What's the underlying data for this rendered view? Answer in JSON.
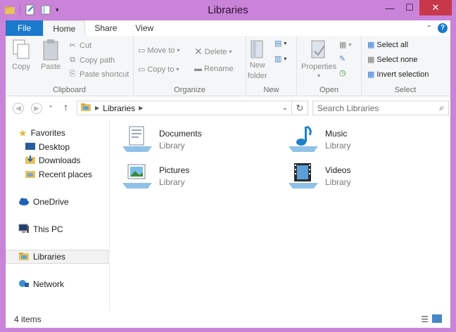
{
  "window": {
    "title": "Libraries"
  },
  "tabs": [
    {
      "label": "File"
    },
    {
      "label": "Home"
    },
    {
      "label": "Share"
    },
    {
      "label": "View"
    }
  ],
  "ribbon": {
    "clipboard": {
      "label": "Clipboard",
      "copy": "Copy",
      "paste": "Paste",
      "cut": "Cut",
      "copy_path": "Copy path",
      "paste_shortcut": "Paste shortcut"
    },
    "organize": {
      "label": "Organize",
      "move_to": "Move to",
      "copy_to": "Copy to",
      "delete": "Delete",
      "rename": "Rename"
    },
    "new": {
      "label": "New",
      "new_folder_line1": "New",
      "new_folder_line2": "folder"
    },
    "open": {
      "label": "Open",
      "properties": "Properties"
    },
    "select": {
      "label": "Select",
      "select_all": "Select all",
      "select_none": "Select none",
      "invert_selection": "Invert selection"
    }
  },
  "address": {
    "path": "Libraries",
    "search_placeholder": "Search Libraries"
  },
  "navpane": {
    "favorites": "Favorites",
    "desktop": "Desktop",
    "downloads": "Downloads",
    "recent_places": "Recent places",
    "onedrive": "OneDrive",
    "this_pc": "This PC",
    "libraries": "Libraries",
    "network": "Network"
  },
  "libraries": [
    {
      "name": "Documents",
      "type": "Library"
    },
    {
      "name": "Music",
      "type": "Library"
    },
    {
      "name": "Pictures",
      "type": "Library"
    },
    {
      "name": "Videos",
      "type": "Library"
    }
  ],
  "status": {
    "items": "4 items"
  },
  "colors": {
    "accent": "#1979ca",
    "frame": "#c983d8",
    "close": "#c7384a"
  }
}
